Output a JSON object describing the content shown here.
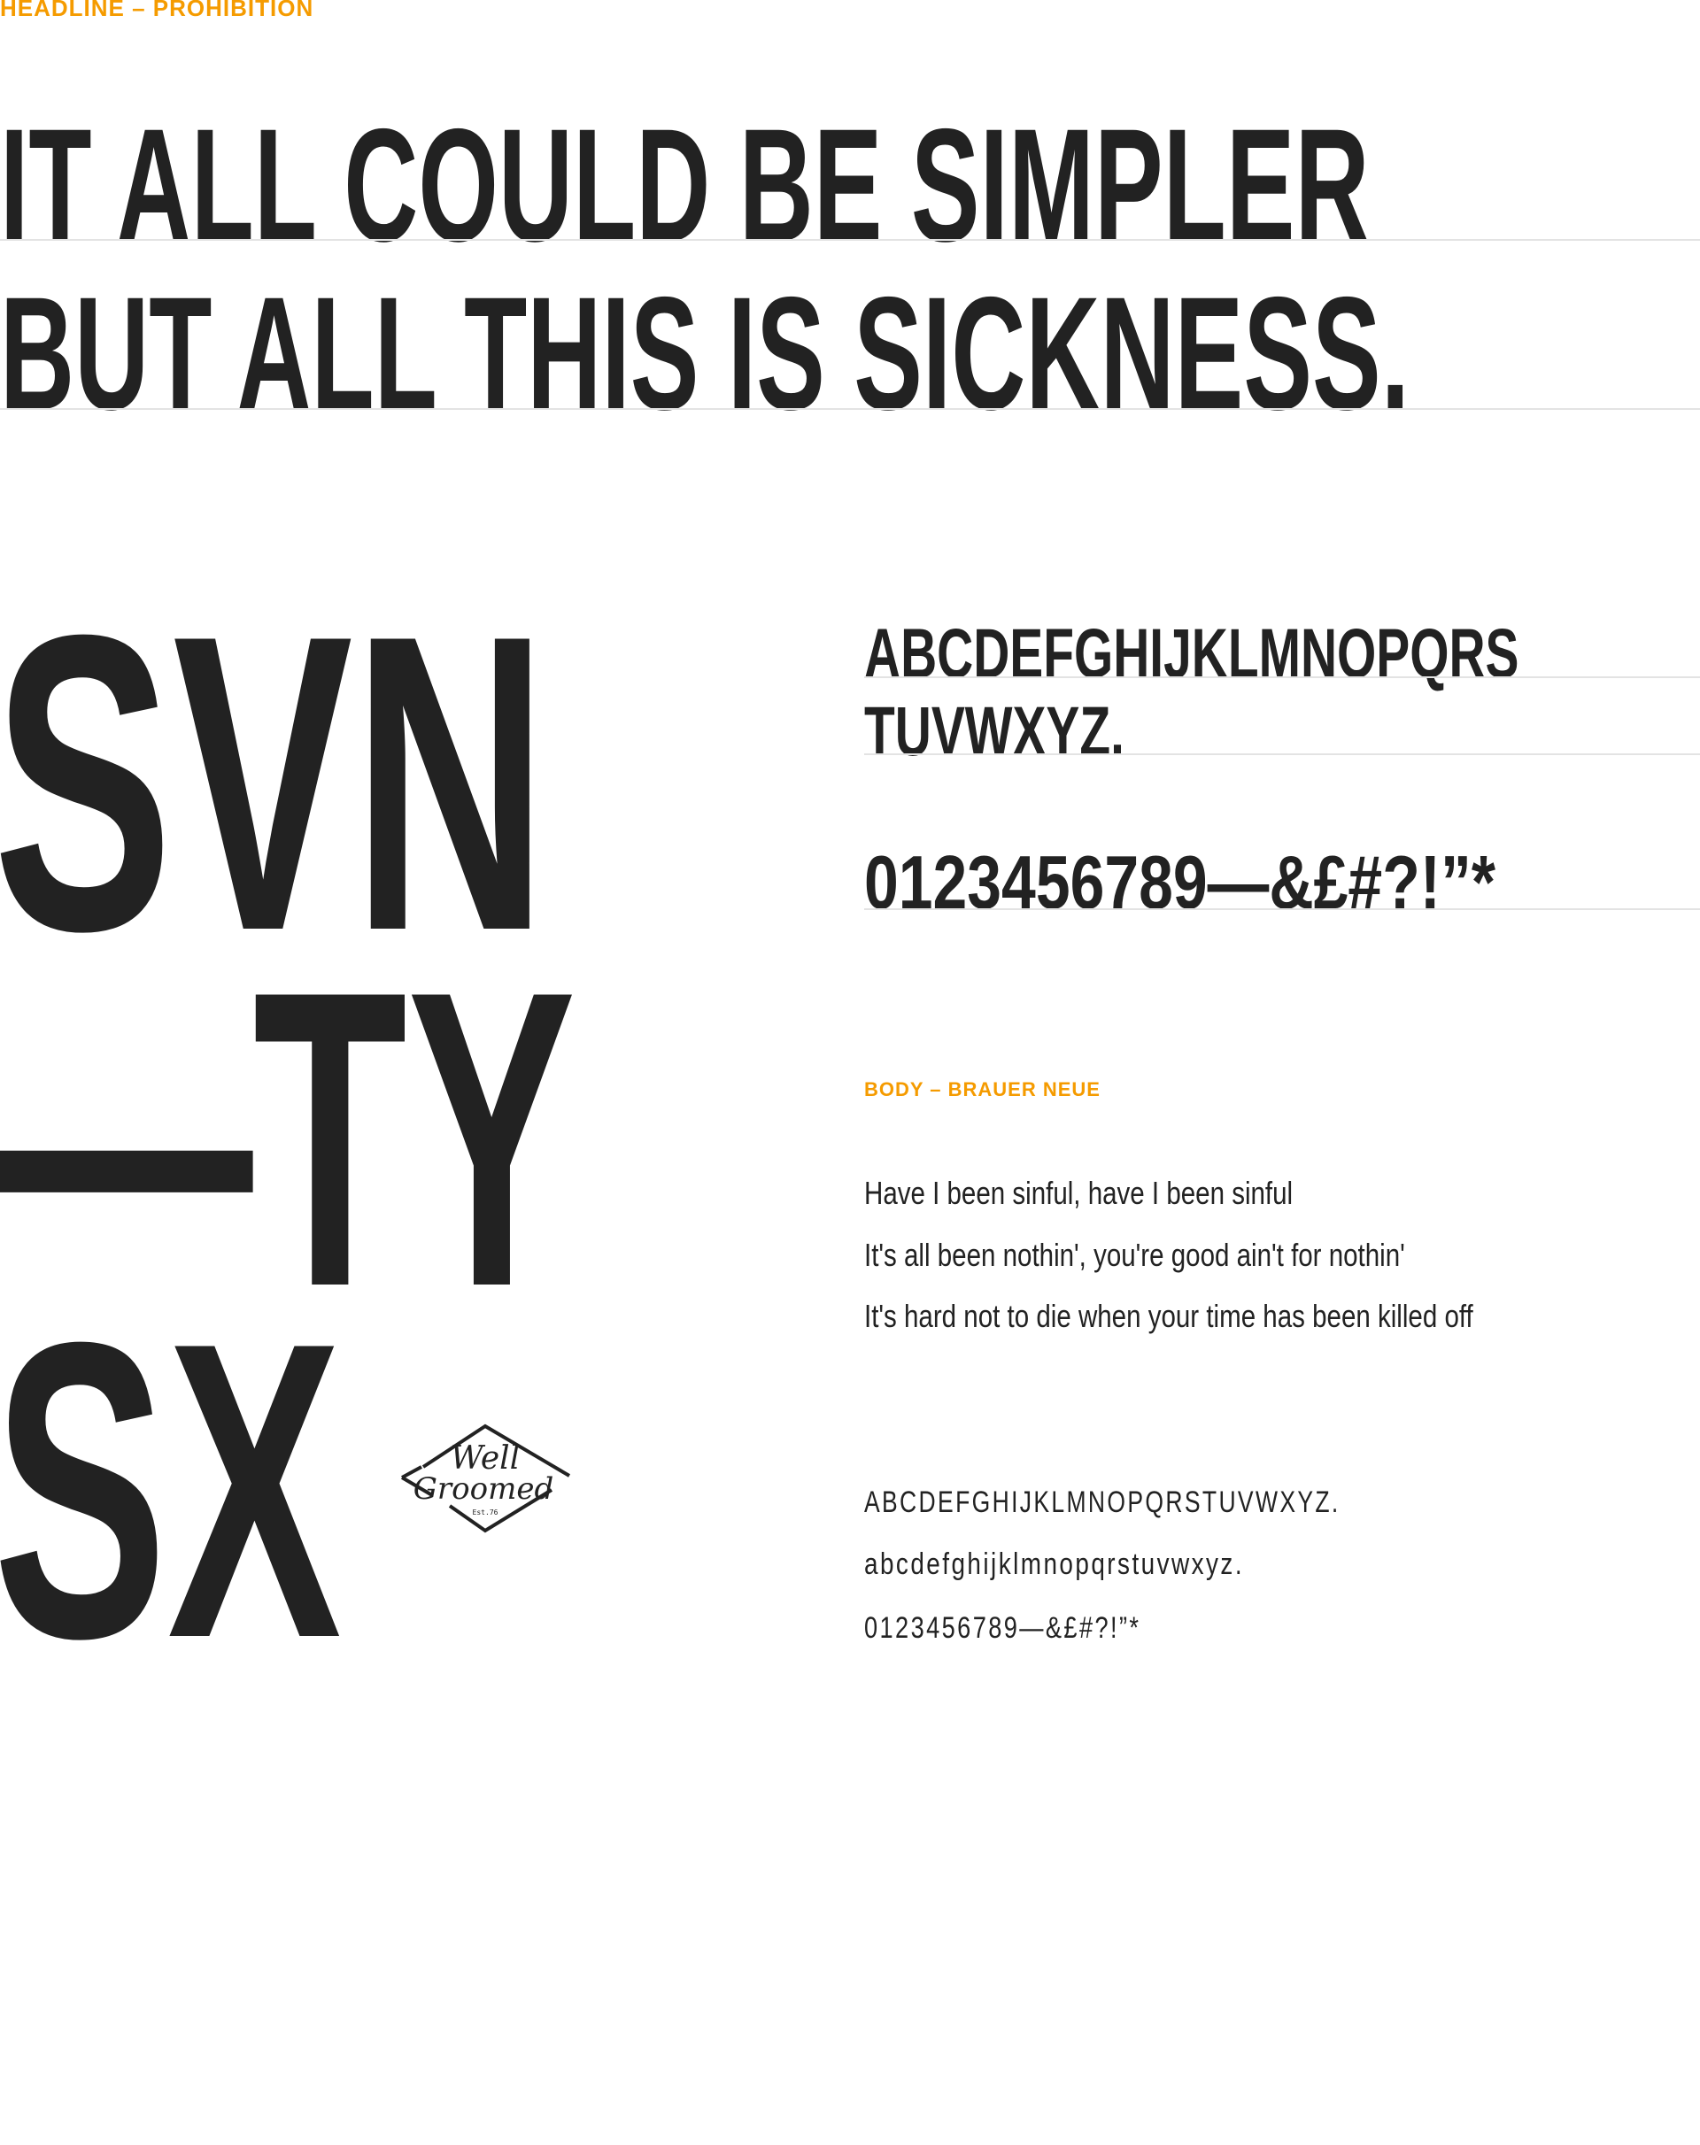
{
  "headline_label": "HEADLINE – PROHIBITION",
  "headline_lines": [
    "IT ALL COULD BE SIMPLER",
    "BUT ALL THIS IS SICKNESS."
  ],
  "display": [
    "SVN",
    "—TY",
    "SX"
  ],
  "logo": {
    "line1": "Well",
    "line2": "Groomed",
    "est": "Est.76"
  },
  "headline_specimen": {
    "upper1": "ABCDEFGHIJKLMNOPQRS",
    "upper2": "TUVWXYZ.",
    "numerals": "0123456789—&£#?!”*"
  },
  "body_label": "BODY – BRAUER NEUE",
  "body_lines": [
    "Have I been sinful, have I been sinful",
    "It's all been nothin', you're good ain't for nothin'",
    "It's hard not to die when your time has been killed off"
  ],
  "body_specimen": {
    "upper": "ABCDEFGHIJKLMNOPQRSTUVWXYZ.",
    "lower": "abcdefghijklmnopqrstuvwxyz.",
    "numerals": "0123456789—&£#?!”*"
  },
  "colors": {
    "accent": "#f59b00",
    "text": "#222222"
  }
}
